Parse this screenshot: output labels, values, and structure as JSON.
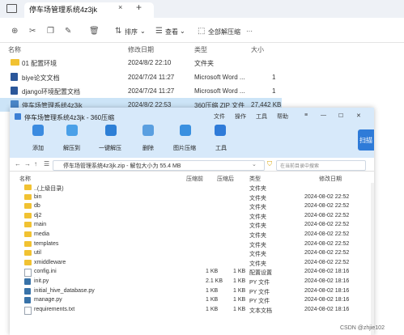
{
  "explorer": {
    "tab_title": "停车场管理系统4z3jk",
    "tab_close": "×",
    "tab_add": "+",
    "toolbar": {
      "sort_label": "排序",
      "sort_chevron": "⌄",
      "view_label": "查看",
      "view_chevron": "⌄",
      "extract_label": "全部解压缩",
      "more_label": "···"
    },
    "columns": [
      "名称",
      "修改日期",
      "类型",
      "大小"
    ],
    "rows": [
      {
        "name": "01 配置环境",
        "date": "2024/8/2 22:10",
        "type": "文件夹",
        "size": "",
        "kind": "folder"
      },
      {
        "name": "biye论文文档",
        "date": "2024/7/24 11:27",
        "type": "Microsoft Word ...",
        "size": "1",
        "kind": "doc"
      },
      {
        "name": "django环境配置文档",
        "date": "2024/7/24 11:27",
        "type": "Microsoft Word ...",
        "size": "1",
        "kind": "doc"
      },
      {
        "name": "停车场管理系统4z3jk",
        "date": "2024/8/2 22:53",
        "type": "360压缩 ZIP 文件",
        "size": "27,442 KB",
        "kind": "zip"
      }
    ]
  },
  "zip": {
    "title": "停车场管理系统4z3jk - 360压缩",
    "menu": [
      "文件",
      "操作",
      "工具",
      "帮助"
    ],
    "toolbar": [
      {
        "label": "添加",
        "color": "#3b8be0"
      },
      {
        "label": "解压到",
        "color": "#4aa0e8"
      },
      {
        "label": "一键解压",
        "color": "#2d7fd6"
      },
      {
        "label": "删除",
        "color": "#5a9fe0"
      },
      {
        "label": "图片压缩",
        "color": "#3a90e0"
      },
      {
        "label": "工具",
        "color": "#2f7bd8"
      }
    ],
    "scan_label": "扫描",
    "path": "停车场管理系统4z3jk.zip - 解包大小为 55.4 MB",
    "chevron": "⌄",
    "search_placeholder": "在当前目录中搜索",
    "columns": [
      "名称",
      "压缩前",
      "压缩后",
      "类型",
      "修改日期"
    ],
    "rows": [
      {
        "name": "..(上级目录)",
        "before": "",
        "after": "",
        "type": "文件夹",
        "date": "",
        "kind": "folder"
      },
      {
        "name": "bin",
        "before": "",
        "after": "",
        "type": "文件夹",
        "date": "2024-08-02 22:52",
        "kind": "folder"
      },
      {
        "name": "db",
        "before": "",
        "after": "",
        "type": "文件夹",
        "date": "2024-08-02 22:52",
        "kind": "folder"
      },
      {
        "name": "dj2",
        "before": "",
        "after": "",
        "type": "文件夹",
        "date": "2024-08-02 22:52",
        "kind": "folder"
      },
      {
        "name": "main",
        "before": "",
        "after": "",
        "type": "文件夹",
        "date": "2024-08-02 22:52",
        "kind": "folder"
      },
      {
        "name": "media",
        "before": "",
        "after": "",
        "type": "文件夹",
        "date": "2024-08-02 22:52",
        "kind": "folder"
      },
      {
        "name": "templates",
        "before": "",
        "after": "",
        "type": "文件夹",
        "date": "2024-08-02 22:52",
        "kind": "folder"
      },
      {
        "name": "util",
        "before": "",
        "after": "",
        "type": "文件夹",
        "date": "2024-08-02 22:52",
        "kind": "folder"
      },
      {
        "name": "xmiddleware",
        "before": "",
        "after": "",
        "type": "文件夹",
        "date": "2024-08-02 22:52",
        "kind": "folder"
      },
      {
        "name": "config.ini",
        "before": "1 KB",
        "after": "1 KB",
        "type": "配置设置",
        "date": "2024-08-02 18:16",
        "kind": "file"
      },
      {
        "name": "init.py",
        "before": "2.1 KB",
        "after": "1 KB",
        "type": "PY 文件",
        "date": "2024-08-02 18:16",
        "kind": "py"
      },
      {
        "name": "initial_hive_database.py",
        "before": "1 KB",
        "after": "1 KB",
        "type": "PY 文件",
        "date": "2024-08-02 18:16",
        "kind": "py"
      },
      {
        "name": "manage.py",
        "before": "1 KB",
        "after": "1 KB",
        "type": "PY 文件",
        "date": "2024-08-02 18:16",
        "kind": "py"
      },
      {
        "name": "requirements.txt",
        "before": "1 KB",
        "after": "1 KB",
        "type": "文本文档",
        "date": "2024-08-02 18:16",
        "kind": "file"
      }
    ]
  },
  "watermark": "CSDN @zhjie102"
}
